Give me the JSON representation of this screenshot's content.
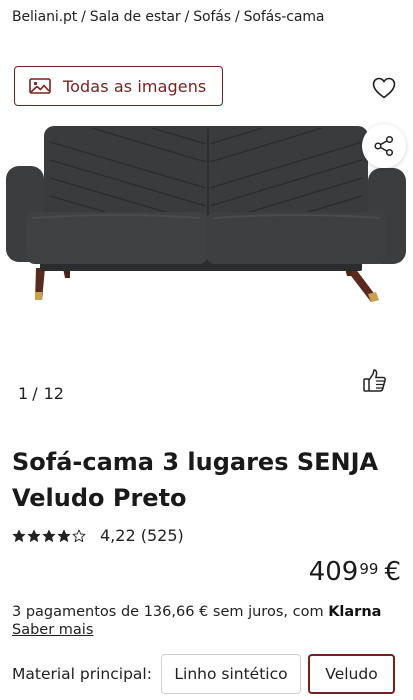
{
  "breadcrumb": {
    "items": [
      "Beliani.pt",
      "Sala de estar",
      "Sofás",
      "Sofás-cama"
    ],
    "separator": "/"
  },
  "gallery": {
    "all_images_label": "Todas as imagens",
    "current": "1",
    "total": "12",
    "separator": "/"
  },
  "product": {
    "title": "Sofá-cama 3 lugares SENJA Veludo Preto",
    "rating_value": 4.22,
    "rating_text": "4,22 (525)",
    "stars_filled": 4,
    "stars_total": 5
  },
  "price": {
    "integer": "409",
    "decimals": "99",
    "currency": "€"
  },
  "financing": {
    "text": "3 pagamentos de 136,66 € sem juros, com",
    "provider": "Klarna",
    "more_link": "Saber mais"
  },
  "material": {
    "label": "Material principal:",
    "options": [
      "Linho sintético",
      "Veludo"
    ],
    "selected": "Veludo"
  },
  "icons": {
    "image": "image-icon",
    "wishlist": "heart-icon",
    "share": "share-icon",
    "like": "thumbs-up-icon",
    "star": "star-icon"
  },
  "colors": {
    "accent": "#7a1f1f",
    "text": "#1a1a1a",
    "border": "#cfcfcf",
    "sofa": "#3a3b3d",
    "legs": "#5b2a1e",
    "leg_caps": "#c9a24b"
  }
}
